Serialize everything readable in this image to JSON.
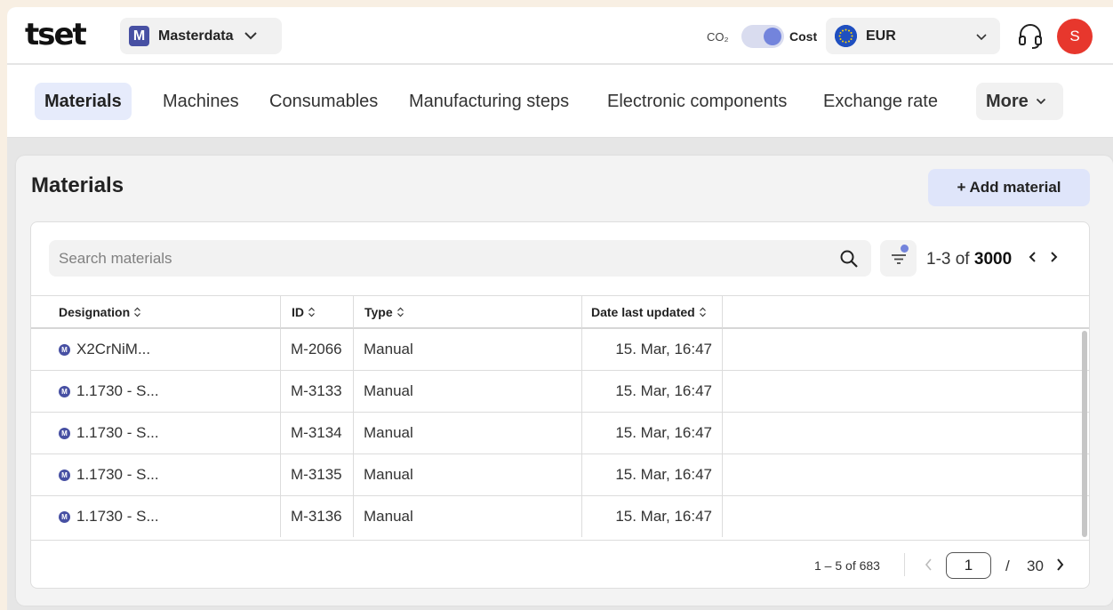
{
  "header": {
    "logo": "tset",
    "workspace": {
      "badge": "M",
      "label": "Masterdata"
    },
    "co2_label": "CO₂",
    "cost_label": "Cost",
    "currency": "EUR",
    "avatar_initial": "S"
  },
  "nav": {
    "items": [
      "Materials",
      "Machines",
      "Consumables",
      "Manufacturing steps",
      "Electronic components",
      "Exchange rate"
    ],
    "active": "Materials",
    "more_label": "More"
  },
  "page": {
    "title": "Materials",
    "add_button": "+ Add material"
  },
  "search": {
    "placeholder": "Search materials",
    "count_prefix": "1-3 of ",
    "count_total": "3000"
  },
  "table": {
    "columns": [
      "Designation",
      "ID",
      "Type",
      "Date last updated"
    ],
    "row_badge": "M",
    "rows": [
      {
        "designation": "X2CrNiM...",
        "id": "M-2066",
        "type": "Manual",
        "date": "15. Mar, 16:47"
      },
      {
        "designation": "1.1730 - S...",
        "id": "M-3133",
        "type": "Manual",
        "date": "15. Mar, 16:47"
      },
      {
        "designation": "1.1730 - S...",
        "id": "M-3134",
        "type": "Manual",
        "date": "15. Mar, 16:47"
      },
      {
        "designation": "1.1730 - S...",
        "id": "M-3135",
        "type": "Manual",
        "date": "15. Mar, 16:47"
      },
      {
        "designation": "1.1730 - S...",
        "id": "M-3136",
        "type": "Manual",
        "date": "15. Mar, 16:47"
      }
    ]
  },
  "pagination": {
    "range": "1 – 5 of 683",
    "current_page": "1",
    "separator": "/",
    "total_pages": "30"
  },
  "colors": {
    "accent": "#4750a3",
    "toggle_knob": "#7384dc",
    "avatar": "#e7372d",
    "active_tab_bg": "#e6ebfb",
    "add_button_bg": "#dfe5fa"
  },
  "icons": [
    "chevron-down-icon",
    "headset-icon",
    "eu-flag-icon",
    "search-icon",
    "filter-icon",
    "sort-icon",
    "chevron-left-icon",
    "chevron-right-icon"
  ]
}
